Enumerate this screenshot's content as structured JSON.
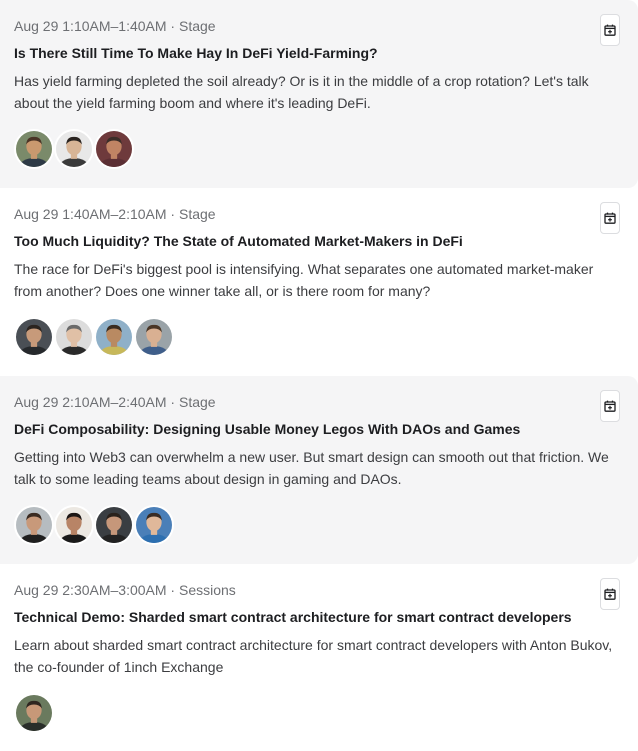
{
  "sessions": [
    {
      "time": "Aug 29 1:10AM–1:40AM · Stage",
      "title": "Is There Still Time To Make Hay In DeFi Yield-Farming?",
      "description": "Has yield farming depleted the soil already? Or is it in the middle of a crop rotation? Let's talk about the yield farming boom and where it's leading DeFi.",
      "calendar_icon": "calendar-add-icon",
      "speakers": [
        {
          "skin": "#c9996f",
          "hair": "#4a3426",
          "bg": "#7a8a6a",
          "shirt": "#2e3a46"
        },
        {
          "skin": "#d8b596",
          "hair": "#2a2420",
          "bg": "#e8e8e8",
          "shirt": "#3b3b3b"
        },
        {
          "skin": "#c08464",
          "hair": "#3b2d28",
          "bg": "#6e3a3c",
          "shirt": "#5b2f34"
        }
      ]
    },
    {
      "time": "Aug 29 1:40AM–2:10AM · Stage",
      "title": "Too Much Liquidity? The State of Automated Market-Makers in DeFi",
      "description": "The race for DeFi's biggest pool is intensifying. What separates one automated market-maker from another? Does one winner take all, or is there room for many?",
      "calendar_icon": "calendar-add-icon",
      "speakers": [
        {
          "skin": "#c79a7a",
          "hair": "#2b241f",
          "bg": "#4a4f55",
          "shirt": "#26292c"
        },
        {
          "skin": "#e0c0a6",
          "hair": "#6a6a6a",
          "bg": "#dcdcdc",
          "shirt": "#2a2a2a"
        },
        {
          "skin": "#b98a62",
          "hair": "#3a2c20",
          "bg": "#8fb0c8",
          "shirt": "#c7b85a"
        },
        {
          "skin": "#d9b092",
          "hair": "#4a3626",
          "bg": "#9aa3a8",
          "shirt": "#3f5e8a"
        }
      ]
    },
    {
      "time": "Aug 29 2:10AM–2:40AM · Stage",
      "title": "DeFi Composability: Designing Usable Money Legos With DAOs and Games",
      "description": "Getting into Web3 can overwhelm a new user. But smart design can smooth out that friction. We talk to some leading teams about design in gaming and DAOs.",
      "calendar_icon": "calendar-add-icon",
      "speakers": [
        {
          "skin": "#c8997a",
          "hair": "#3a2a20",
          "bg": "#b6bcc0",
          "shirt": "#1f1f1f"
        },
        {
          "skin": "#b88466",
          "hair": "#1c1614",
          "bg": "#ece8e2",
          "shirt": "#1a1a1a"
        },
        {
          "skin": "#c6977a",
          "hair": "#2a221c",
          "bg": "#3a3e42",
          "shirt": "#222222"
        },
        {
          "skin": "#e0b89a",
          "hair": "#3a2c24",
          "bg": "#4a7fb8",
          "shirt": "#2d6fb0"
        }
      ]
    },
    {
      "time": "Aug 29 2:30AM–3:00AM · Sessions",
      "title": "Technical Demo: Sharded smart contract architecture for smart contract developers",
      "description": "Learn about sharded smart contract architecture for smart contract developers with Anton Bukov, the co-founder of 1inch Exchange",
      "calendar_icon": "calendar-add-icon",
      "speakers": [
        {
          "skin": "#c79878",
          "hair": "#2e2620",
          "bg": "#6a7a5e",
          "shirt": "#2a2e2a"
        }
      ]
    }
  ]
}
